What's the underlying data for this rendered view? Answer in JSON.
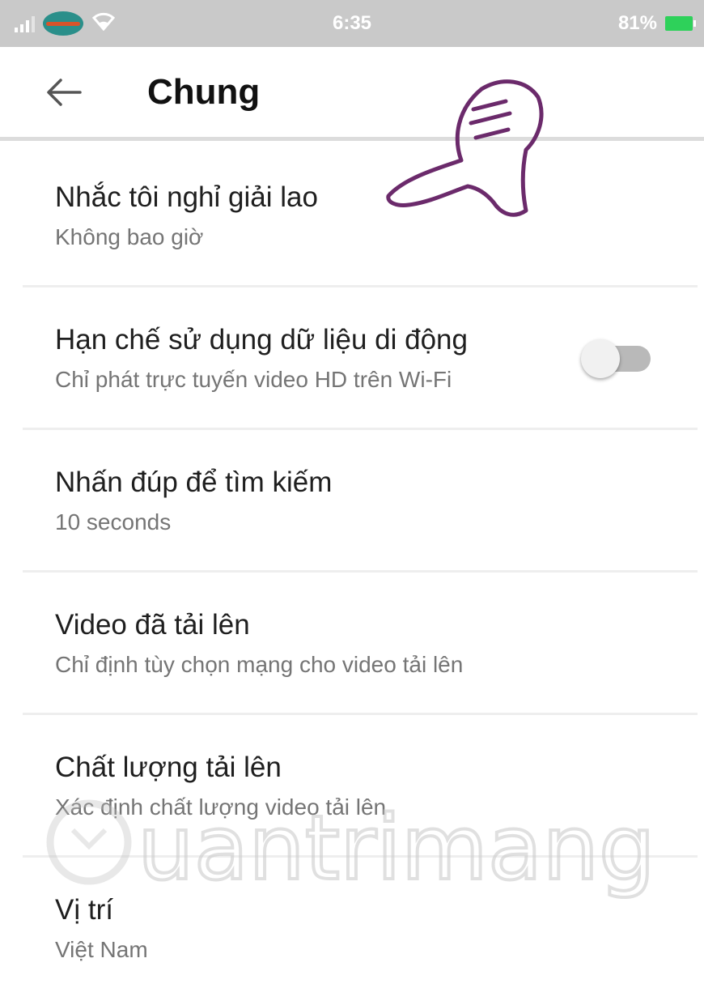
{
  "status_bar": {
    "time": "6:35",
    "battery": "81%",
    "carrier_icon": "carrier-logo-icon",
    "wifi_icon": "wifi-icon",
    "signal_icon": "signal-icon",
    "battery_icon": "battery-icon",
    "battery_color": "#2ed15a"
  },
  "app_bar": {
    "title": "Chung",
    "back_icon": "back-arrow-icon"
  },
  "settings": [
    {
      "title": "Nhắc tôi nghỉ giải lao",
      "subtitle": "Không bao giờ"
    },
    {
      "title": "Hạn chế sử dụng dữ liệu di động",
      "subtitle": "Chỉ phát trực tuyến video HD trên Wi-Fi",
      "toggle": false
    },
    {
      "title": "Nhấn đúp để tìm kiếm",
      "subtitle": "10 seconds"
    },
    {
      "title": "Video đã tải lên",
      "subtitle": "Chỉ định tùy chọn mạng cho video tải lên"
    },
    {
      "title": "Chất lượng tải lên",
      "subtitle": "Xác định chất lượng video tải lên"
    },
    {
      "title": "Vị trí",
      "subtitle": "Việt Nam"
    }
  ],
  "overlay": {
    "annotation_icon": "pointing-hand-icon",
    "annotation_color": "#6b2a6b"
  },
  "watermark": {
    "text": "Quantrimang",
    "icon": "lightbulb-icon"
  }
}
